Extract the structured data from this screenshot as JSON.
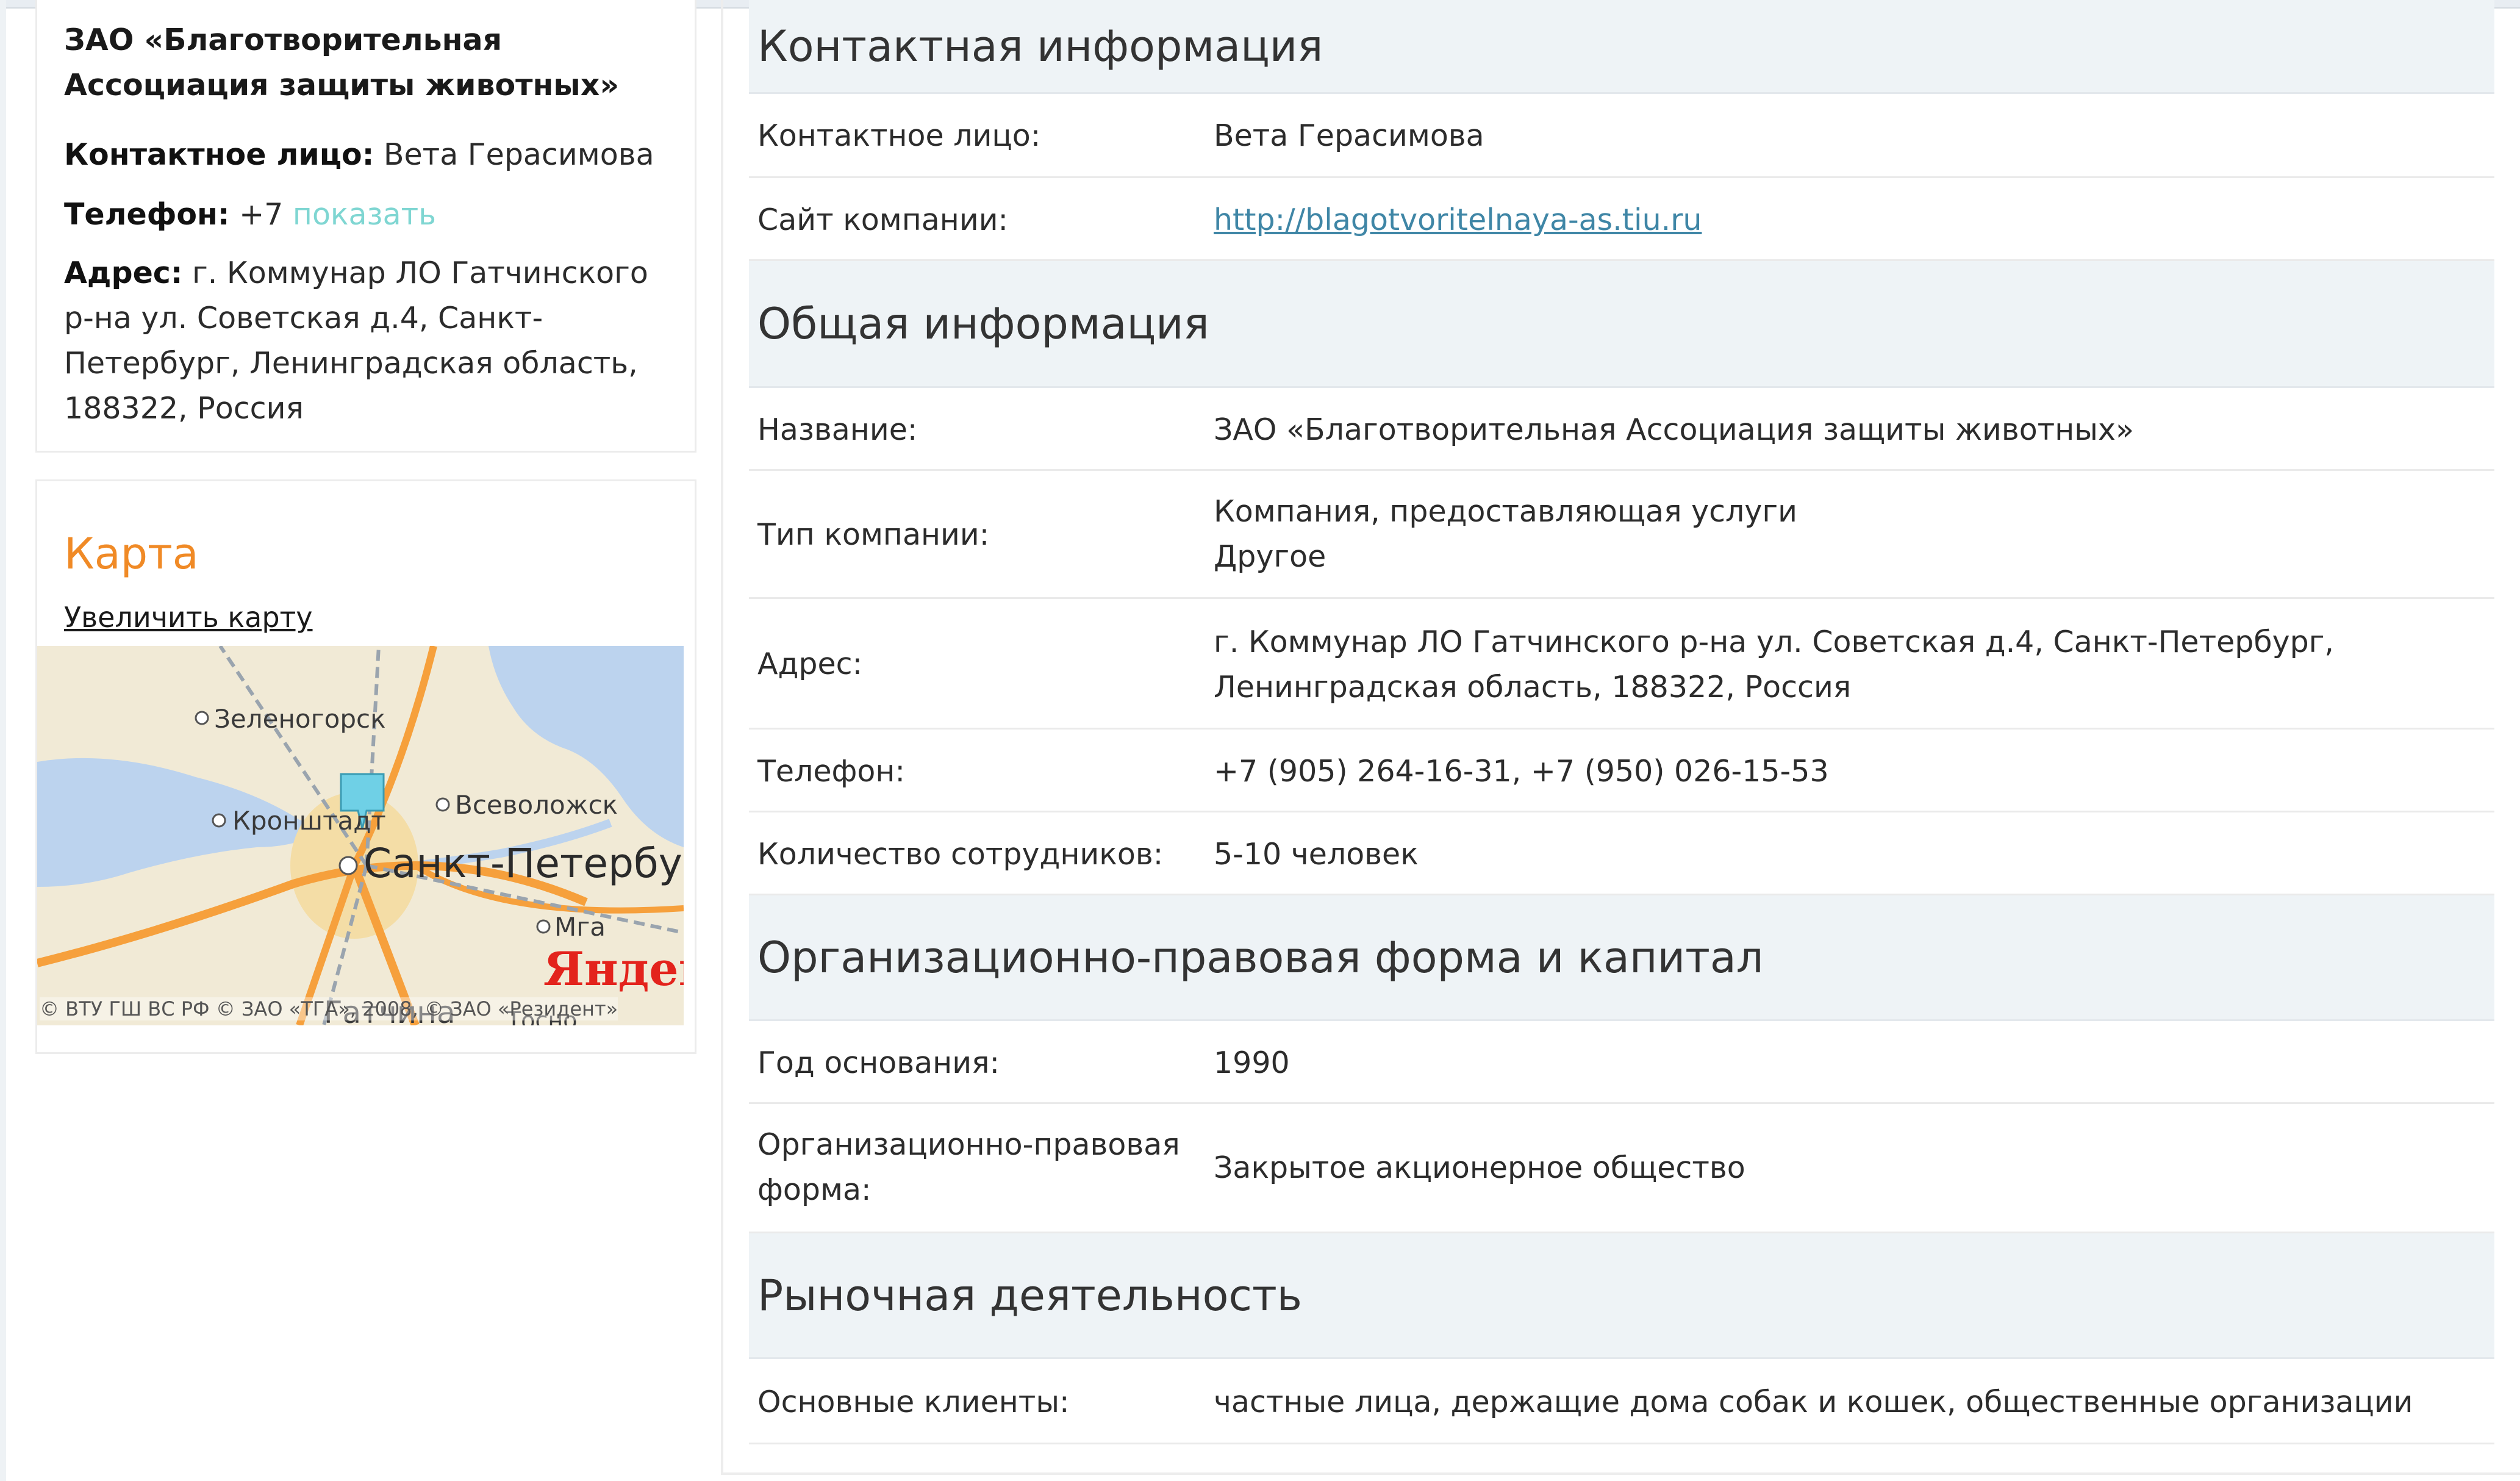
{
  "left_panel": {
    "company_name": "ЗАО «Благотворительная Ассоциация защиты животных»",
    "contact_label": "Контактное лицо:",
    "contact_value": "Вета Герасимова",
    "phone_label": "Телефон:",
    "phone_value": "+7",
    "phone_show_link": "показать",
    "address_label": "Адрес:",
    "address_value": "г. Коммунар ЛО Гатчинского р-на ул. Советская д.4, Санкт-Петербург, Ленинградская область, 188322, Россия"
  },
  "map_card": {
    "title": "Карта",
    "enlarge_link": "Увеличить карту",
    "labels": {
      "zelenogorsk": "Зеленогорск",
      "kronstadt": "Кронштадт",
      "vsevolozhsk": "Всеволожск",
      "spb": "Санкт-Петербург",
      "mga": "Мга",
      "gatchina": "Гатчина",
      "tosno": "Тосно",
      "yandex": "Яндекс",
      "copyright": "© ВТУ ГШ ВС РФ © ЗАО «ТГА», 2008, © ЗАО «Резидент»"
    }
  },
  "sections": {
    "contact": {
      "title": "Контактная информация",
      "rows": [
        {
          "label": "Контактное лицо:",
          "value": "Вета Герасимова"
        },
        {
          "label": "Сайт компании:",
          "value": "http://blagotvoritelnaya-as.tiu.ru"
        }
      ]
    },
    "general": {
      "title": "Общая информация",
      "rows": [
        {
          "label": "Название:",
          "value": "ЗАО «Благотворительная Ассоциация защиты животных»"
        },
        {
          "label": "Тип компании:",
          "value_line1": "Компания, предоставляющая услуги",
          "value_line2": "Другое"
        },
        {
          "label": "Адрес:",
          "value": "г. Коммунар ЛО Гатчинского р-на ул. Советская д.4, Санкт-Петербург, Ленинградская область, 188322, Россия"
        },
        {
          "label": "Телефон:",
          "value": "+7 (905) 264-16-31, +7 (950) 026-15-53"
        },
        {
          "label": "Количество сотрудников:",
          "value": "5-10 человек"
        }
      ]
    },
    "legal": {
      "title": "Организационно-правовая форма и капитал",
      "rows": [
        {
          "label": "Год основания:",
          "value": "1990"
        },
        {
          "label": "Организационно-правовая форма:",
          "value": "Закрытое акционерное общество"
        }
      ]
    },
    "market": {
      "title": "Рыночная деятельность",
      "rows": [
        {
          "label": "Основные клиенты:",
          "value": "частные лица, держащие дома собак и кошек, общественные организации"
        }
      ]
    }
  },
  "colors": {
    "accent_orange": "#f08a26",
    "link_teal": "#7fd6d2",
    "link_blue": "#3f86a6",
    "section_bg": "#eef3f6",
    "map_water": "#bcd3ee",
    "map_road": "#f6a03c",
    "map_pin": "#6fd0e6",
    "yandex_red": "#e3231c"
  }
}
